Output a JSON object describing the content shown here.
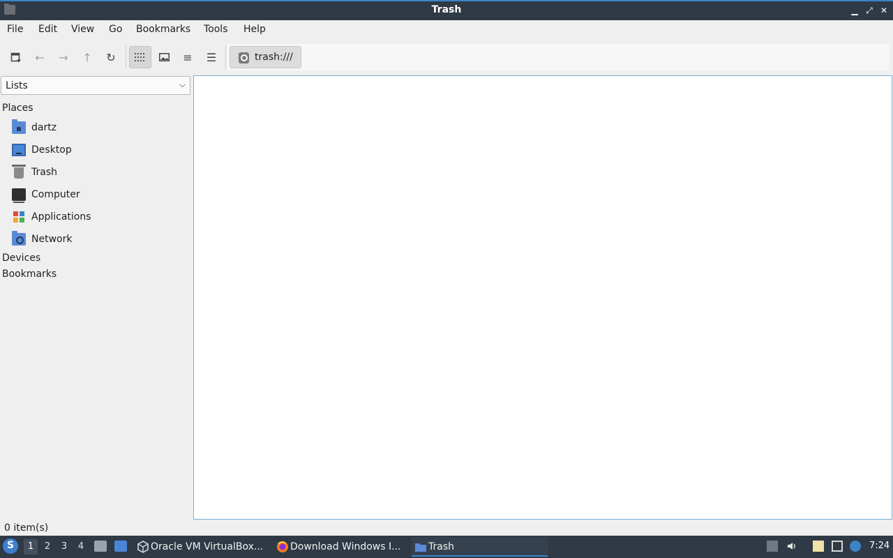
{
  "window": {
    "title": "Trash",
    "controls": {
      "minimize": "▁",
      "maximize": "⤢",
      "close": "✕"
    }
  },
  "menu": [
    "File",
    "Edit",
    "View",
    "Go",
    "Bookmarks",
    "Tools",
    "Help"
  ],
  "toolbar": {
    "new_tab_icon": "new-tab-icon",
    "back_icon": "←",
    "forward_icon": "→",
    "up_icon": "↑",
    "reload_icon": "↻",
    "view_icons": "⋮⋮⋮",
    "view_thumbnails": "▣",
    "view_compact": "≡",
    "view_detailed": "☰",
    "path": "trash:///"
  },
  "sidebar": {
    "selector": "Lists",
    "sections": {
      "places": "Places",
      "devices": "Devices",
      "bookmarks": "Bookmarks"
    },
    "places": [
      {
        "label": "dartz",
        "icon": "home-folder-icon"
      },
      {
        "label": "Desktop",
        "icon": "desktop-icon"
      },
      {
        "label": "Trash",
        "icon": "trash-icon"
      },
      {
        "label": "Computer",
        "icon": "computer-icon"
      },
      {
        "label": "Applications",
        "icon": "applications-icon"
      },
      {
        "label": "Network",
        "icon": "network-folder-icon"
      }
    ]
  },
  "status": {
    "text": "0 item(s)"
  },
  "taskbar": {
    "workspaces": [
      "1",
      "2",
      "3",
      "4"
    ],
    "active_workspace": "1",
    "tasks": [
      {
        "label": "Oracle VM VirtualBox...",
        "icon": "virtualbox-icon"
      },
      {
        "label": "Download Windows I...",
        "icon": "firefox-icon"
      },
      {
        "label": "Trash",
        "icon": "folder-icon"
      }
    ],
    "clock": "7:24"
  },
  "colors": {
    "titlebar": "#2f3a46",
    "accent": "#3b84c8",
    "content_border": "#74b2d8",
    "folder_blue": "#5a8ad6"
  }
}
